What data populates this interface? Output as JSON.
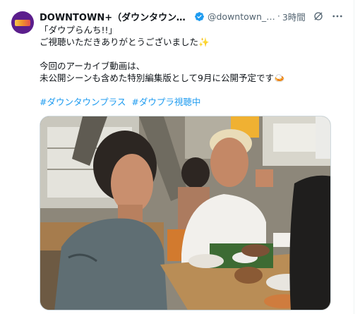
{
  "tweet": {
    "display_name": "DOWNTOWN+（ダウンタウンプラス…",
    "handle": "@downtown_pl…",
    "separator": "·",
    "time": "3時間",
    "lines": [
      "「ダウプらんち!!」",
      "ご視聴いただきありがとうございました",
      "",
      "今回のアーカイブ動画は、",
      "未公開シーンも含めた特別編集版として9月に公開予定です"
    ],
    "emoji_1": "✨",
    "emoji_2": "🍛",
    "hashtags": [
      "#ダウンタウンプラス",
      "#ダウプラ視聴中"
    ]
  },
  "colors": {
    "link": "#1d9bf0",
    "muted": "#536471",
    "verified": "#1d9bf0",
    "avatar_bg": "#5b1e8c"
  },
  "icons": {
    "verified": "verified-badge-icon",
    "grok": "grok-icon",
    "more": "more-icon"
  }
}
